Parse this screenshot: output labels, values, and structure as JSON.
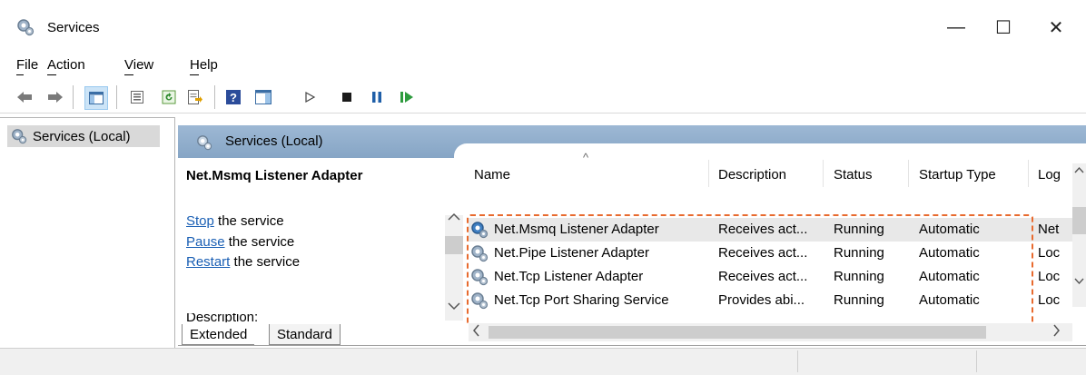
{
  "window": {
    "title": "Services",
    "controls": {
      "minimize": "—",
      "maximize": "☐",
      "close": "✕"
    }
  },
  "menu": [
    {
      "label": "File"
    },
    {
      "label": "Action"
    },
    {
      "label": "View"
    },
    {
      "label": "Help"
    }
  ],
  "toolbar": {
    "icons": [
      "back-icon",
      "forward-icon",
      "show-hide-console-tree-icon",
      "properties-icon",
      "refresh-icon",
      "export-list-icon",
      "help-icon",
      "action-pane-icon",
      "start-service-icon",
      "stop-service-icon",
      "pause-service-icon",
      "resume-service-icon"
    ]
  },
  "tree": {
    "item": "Services (Local)"
  },
  "header": {
    "title": "Services (Local)"
  },
  "info": {
    "service_name": "Net.Msmq Listener Adapter",
    "links": [
      {
        "link": "Stop",
        "rest": " the service"
      },
      {
        "link": "Pause",
        "rest": " the service"
      },
      {
        "link": "Restart",
        "rest": " the service"
      }
    ],
    "description_label": "Description:"
  },
  "list": {
    "columns": [
      "Name",
      "Description",
      "Status",
      "Startup Type",
      "Log"
    ],
    "rows": [
      {
        "name": "Net.Msmq Listener Adapter",
        "description": "Receives act...",
        "status": "Running",
        "startup": "Automatic",
        "logon": "Net",
        "selected": true
      },
      {
        "name": "Net.Pipe Listener Adapter",
        "description": "Receives act...",
        "status": "Running",
        "startup": "Automatic",
        "logon": "Loc",
        "selected": false
      },
      {
        "name": "Net.Tcp Listener Adapter",
        "description": "Receives act...",
        "status": "Running",
        "startup": "Automatic",
        "logon": "Loc",
        "selected": false
      },
      {
        "name": "Net.Tcp Port Sharing Service",
        "description": "Provides abi...",
        "status": "Running",
        "startup": "Automatic",
        "logon": "Loc",
        "selected": false
      }
    ]
  },
  "tabs": [
    {
      "label": "Extended",
      "active": true
    },
    {
      "label": "Standard",
      "active": false
    }
  ],
  "colors": {
    "header_band": "#9db8d4",
    "highlight_border": "#e86a2e",
    "link": "#1a5fb4"
  }
}
